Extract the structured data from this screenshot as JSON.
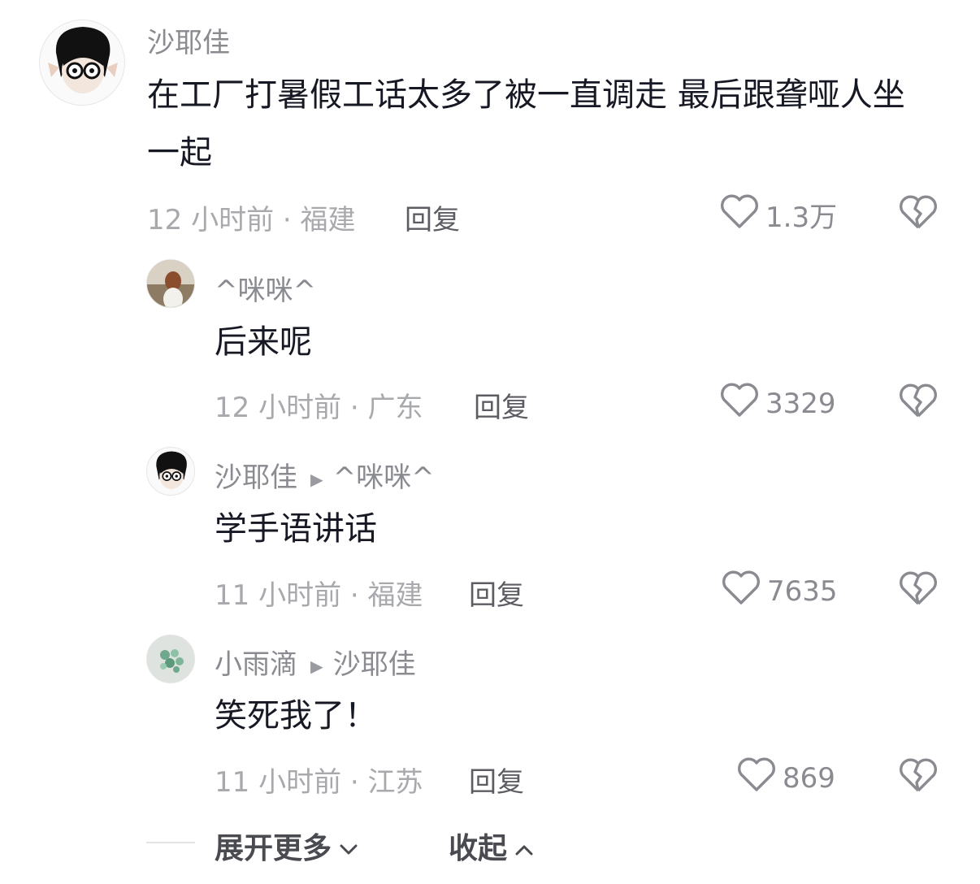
{
  "comments": [
    {
      "username": "沙耶佳",
      "text": "在工厂打暑假工话太多了被一直调走 最后跟聋哑人坐一起",
      "time_location": "12 小时前 · 福建",
      "reply_label": "回复",
      "likes": "1.3万"
    },
    {
      "username": "^咪咪^",
      "text": "后来呢",
      "time_location": "12 小时前 · 广东",
      "reply_label": "回复",
      "likes": "3329"
    },
    {
      "username": "沙耶佳",
      "reply_to": "^咪咪^",
      "text": "学手语讲话",
      "time_location": "11 小时前 · 福建",
      "reply_label": "回复",
      "likes": "7635"
    },
    {
      "username": "小雨滴",
      "reply_to": "沙耶佳",
      "text": "笑死我了！",
      "time_location": "11 小时前 · 江苏",
      "reply_label": "回复",
      "likes": "869"
    }
  ],
  "footer": {
    "expand_label": "展开更多",
    "collapse_label": "收起"
  },
  "icons": {
    "like": "heart-outline-icon",
    "dislike": "broken-heart-icon",
    "expand": "chevron-down-icon",
    "collapse": "chevron-up-icon"
  }
}
